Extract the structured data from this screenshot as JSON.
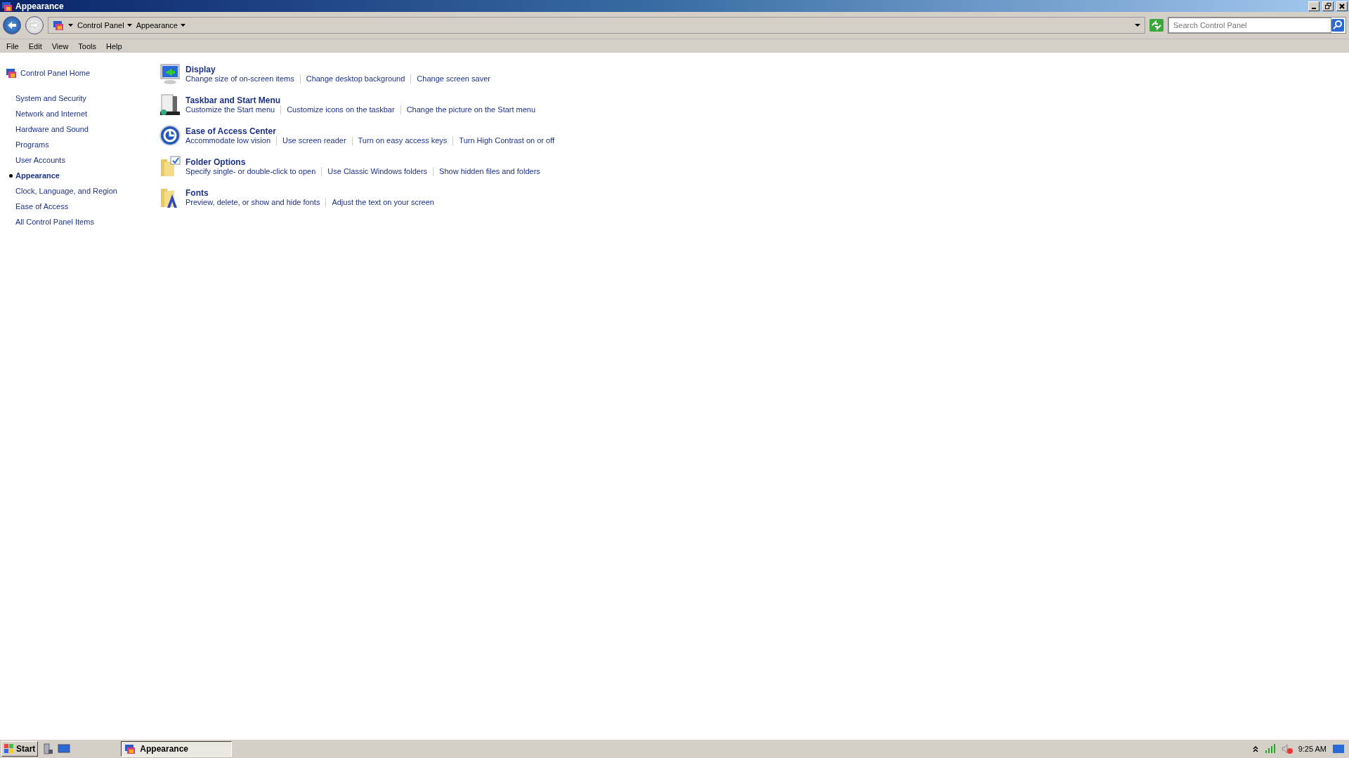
{
  "window": {
    "title": "Appearance"
  },
  "address_bar": {
    "breadcrumbs": [
      "Control Panel",
      "Appearance"
    ]
  },
  "search": {
    "placeholder": "Search Control Panel"
  },
  "menu": [
    "File",
    "Edit",
    "View",
    "Tools",
    "Help"
  ],
  "sidebar": {
    "home": "Control Panel Home",
    "items": [
      {
        "label": "System and Security",
        "selected": false
      },
      {
        "label": "Network and Internet",
        "selected": false
      },
      {
        "label": "Hardware and Sound",
        "selected": false
      },
      {
        "label": "Programs",
        "selected": false
      },
      {
        "label": "User Accounts",
        "selected": false
      },
      {
        "label": "Appearance",
        "selected": true
      },
      {
        "label": "Clock, Language, and Region",
        "selected": false
      },
      {
        "label": "Ease of Access",
        "selected": false
      },
      {
        "label": "All Control Panel Items",
        "selected": false
      }
    ]
  },
  "categories": [
    {
      "kind": "display",
      "title": "Display",
      "links": [
        "Change size of on-screen items",
        "Change desktop background",
        "Change screen saver"
      ]
    },
    {
      "kind": "taskbar",
      "title": "Taskbar and Start Menu",
      "links": [
        "Customize the Start menu",
        "Customize icons on the taskbar",
        "Change the picture on the Start menu"
      ]
    },
    {
      "kind": "access",
      "title": "Ease of Access Center",
      "links": [
        "Accommodate low vision",
        "Use screen reader",
        "Turn on easy access keys",
        "Turn High Contrast on or off"
      ]
    },
    {
      "kind": "folder",
      "title": "Folder Options",
      "links": [
        "Specify single- or double-click to open",
        "Use Classic Windows folders",
        "Show hidden files and folders"
      ]
    },
    {
      "kind": "fonts",
      "title": "Fonts",
      "links": [
        "Preview, delete, or show and hide fonts",
        "Adjust the text on your screen"
      ]
    }
  ],
  "taskbar": {
    "start": "Start",
    "windows": [
      {
        "label": "Appearance",
        "selected": true
      }
    ],
    "clock": "9:25 AM"
  }
}
